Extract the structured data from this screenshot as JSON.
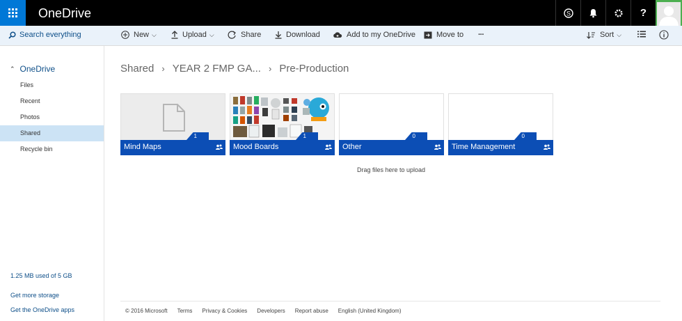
{
  "suitebar": {
    "app_title": "OneDrive"
  },
  "commandbar": {
    "search_label": "Search everything",
    "new_label": "New",
    "upload_label": "Upload",
    "share_label": "Share",
    "download_label": "Download",
    "add_label": "Add to my OneDrive",
    "move_label": "Move to",
    "more_label": "···",
    "sort_label": "Sort"
  },
  "sidebar": {
    "root_label": "OneDrive",
    "items": [
      {
        "label": "Files"
      },
      {
        "label": "Recent"
      },
      {
        "label": "Photos"
      },
      {
        "label": "Shared"
      },
      {
        "label": "Recycle bin"
      }
    ],
    "storage_text": "1.25 MB used of 5 GB",
    "get_storage": "Get more storage",
    "get_apps": "Get the OneDrive apps"
  },
  "breadcrumb": {
    "items": [
      "Shared",
      "YEAR 2 FMP GA...",
      "Pre-Production"
    ]
  },
  "folders": [
    {
      "name": "Mind Maps",
      "count": "1"
    },
    {
      "name": "Mood Boards",
      "count": "1"
    },
    {
      "name": "Other",
      "count": "0"
    },
    {
      "name": "Time Management",
      "count": "0"
    }
  ],
  "dropzone_text": "Drag files here to upload",
  "footer": {
    "copyright": "© 2016 Microsoft",
    "terms": "Terms",
    "privacy": "Privacy & Cookies",
    "developers": "Developers",
    "report": "Report abuse",
    "language": "English (United Kingdom)"
  },
  "colors": {
    "accent": "#0078d7",
    "folder_bar": "#0c4eb5",
    "selected": "#cce3f5"
  }
}
